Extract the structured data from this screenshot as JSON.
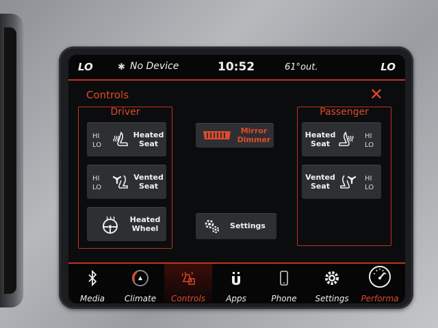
{
  "status_bar": {
    "left_temp": "LO",
    "bluetooth_icon": "bluetooth-icon",
    "device": "No Device",
    "time": "10:52",
    "outside_temp": "61°out.",
    "right_temp": "LO"
  },
  "header": {
    "title": "Controls",
    "close_icon": "close-icon"
  },
  "driver": {
    "title": "Driver",
    "heated_seat": {
      "hi": "HI",
      "lo": "LO",
      "label_line1": "Heated",
      "label_line2": "Seat"
    },
    "vented_seat": {
      "hi": "HI",
      "lo": "LO",
      "label_line1": "Vented",
      "label_line2": "Seat"
    },
    "heated_wheel": {
      "label_line1": "Heated",
      "label_line2": "Wheel"
    }
  },
  "center": {
    "mirror": {
      "label_line1": "Mirror",
      "label_line2": "Dimmer"
    },
    "settings": {
      "label": "Settings"
    }
  },
  "passenger": {
    "title": "Passenger",
    "heated_seat": {
      "hi": "HI",
      "lo": "LO",
      "label_line1": "Heated",
      "label_line2": "Seat"
    },
    "vented_seat": {
      "hi": "HI",
      "lo": "LO",
      "label_line1": "Vented",
      "label_line2": "Seat"
    }
  },
  "nav": {
    "items": [
      {
        "label": "Media",
        "icon": "bluetooth-icon"
      },
      {
        "label": "Climate",
        "icon": "climate-icon"
      },
      {
        "label": "Controls",
        "icon": "controls-icon",
        "active": true
      },
      {
        "label": "Apps",
        "icon": "apps-icon"
      },
      {
        "label": "Phone",
        "icon": "phone-icon"
      },
      {
        "label": "Settings",
        "icon": "gear-icon"
      },
      {
        "label": "Performa",
        "icon": "gauge-icon"
      }
    ]
  },
  "colors": {
    "accent": "#e24a2a",
    "button": "#2e2f33",
    "background": "#0b0c0e"
  }
}
